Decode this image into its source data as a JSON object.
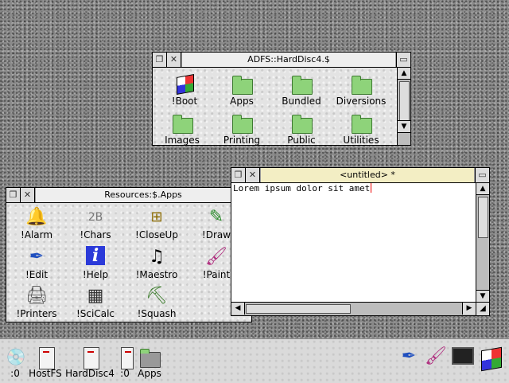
{
  "harddisc_window": {
    "title": "ADFS::HardDisc4.$",
    "items": [
      {
        "label": "!Boot",
        "icon": "boot-cube-icon"
      },
      {
        "label": "Apps",
        "icon": "folder-icon"
      },
      {
        "label": "Bundled",
        "icon": "folder-icon"
      },
      {
        "label": "Diversions",
        "icon": "folder-icon"
      },
      {
        "label": "Images",
        "icon": "folder-icon"
      },
      {
        "label": "Printing",
        "icon": "folder-icon"
      },
      {
        "label": "Public",
        "icon": "folder-icon"
      },
      {
        "label": "Utilities",
        "icon": "folder-icon"
      }
    ]
  },
  "resources_window": {
    "title": "Resources:$.Apps",
    "items": [
      {
        "label": "!Alarm",
        "icon": "alarm-bell-icon"
      },
      {
        "label": "!Chars",
        "icon": "chars-icon"
      },
      {
        "label": "!CloseUp",
        "icon": "closeup-magnifier-icon"
      },
      {
        "label": "!Draw",
        "icon": "draw-icon"
      },
      {
        "label": "!Edit",
        "icon": "edit-pen-icon"
      },
      {
        "label": "!Help",
        "icon": "help-i-icon"
      },
      {
        "label": "!Maestro",
        "icon": "maestro-music-icon"
      },
      {
        "label": "!Paint",
        "icon": "paint-brush-icon"
      },
      {
        "label": "!Printers",
        "icon": "printer-icon"
      },
      {
        "label": "!SciCalc",
        "icon": "calculator-icon"
      },
      {
        "label": "!Squash",
        "icon": "squash-icon"
      }
    ]
  },
  "editor_window": {
    "title": "<untitled> *",
    "text": "Lorem ipsum dolor sit amet"
  },
  "iconbar": {
    "left": [
      {
        "label": ":0",
        "icon": "cd-drive-icon"
      },
      {
        "label": "HostFS",
        "icon": "hostfs-drive-icon"
      },
      {
        "label": "HardDisc4",
        "icon": "harddisc-icon"
      },
      {
        "label": ":0",
        "icon": "floppy-drive-icon"
      },
      {
        "label": "Apps",
        "icon": "apps-folder-icon"
      }
    ],
    "right": [
      {
        "icon": "edit-pen-icon"
      },
      {
        "icon": "paint-brush-icon"
      },
      {
        "icon": "display-manager-icon"
      },
      {
        "icon": "task-manager-cube-icon"
      }
    ]
  }
}
